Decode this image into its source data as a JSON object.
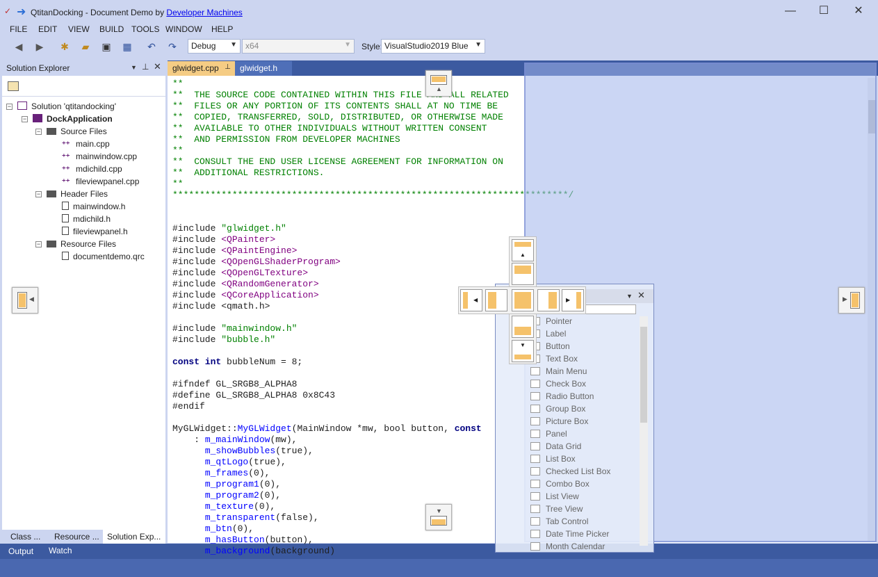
{
  "window": {
    "title": "QtitanDocking - Document Demo by ",
    "title_link": "Developer Machines",
    "minimize": "—",
    "maximize": "☐",
    "close": "✕"
  },
  "menu": [
    "FILE",
    "EDIT",
    "VIEW",
    "BUILD",
    "TOOLS",
    "WINDOW",
    "HELP"
  ],
  "toolbar": {
    "config_value": "Debug",
    "platform_value": "x64",
    "style_label": "Style:",
    "style_value": "VisualStudio2019 Blue"
  },
  "solution_explorer": {
    "title": "Solution Explorer",
    "tree": [
      {
        "label": "Solution 'qtitandocking'",
        "level": 0,
        "kind": "solution"
      },
      {
        "label": "DockApplication",
        "level": 1,
        "kind": "project"
      },
      {
        "label": "Source Files",
        "level": 2,
        "kind": "folder"
      },
      {
        "label": "main.cpp",
        "level": 3,
        "kind": "cpp"
      },
      {
        "label": "mainwindow.cpp",
        "level": 3,
        "kind": "cpp"
      },
      {
        "label": "mdichild.cpp",
        "level": 3,
        "kind": "cpp"
      },
      {
        "label": "fileviewpanel.cpp",
        "level": 3,
        "kind": "cpp"
      },
      {
        "label": "Header Files",
        "level": 2,
        "kind": "folder"
      },
      {
        "label": "mainwindow.h",
        "level": 3,
        "kind": "h"
      },
      {
        "label": "mdichild.h",
        "level": 3,
        "kind": "h"
      },
      {
        "label": "fileviewpanel.h",
        "level": 3,
        "kind": "h"
      },
      {
        "label": "Resource Files",
        "level": 2,
        "kind": "folder"
      },
      {
        "label": "documentdemo.qrc",
        "level": 3,
        "kind": "h"
      }
    ]
  },
  "left_tabs": [
    "Class ...",
    "Resource ...",
    "Solution Exp..."
  ],
  "bottom_tabs": [
    "Output",
    "Watch"
  ],
  "editor_tabs": [
    "glwidget.cpp",
    "glwidget.h"
  ],
  "code_lines": [
    "**",
    "**  THE SOURCE CODE CONTAINED WITHIN THIS FILE AND ALL RELATED",
    "**  FILES OR ANY PORTION OF ITS CONTENTS SHALL AT NO TIME BE",
    "**  COPIED, TRANSFERRED, SOLD, DISTRIBUTED, OR OTHERWISE MADE",
    "**  AVAILABLE TO OTHER INDIVIDUALS WITHOUT WRITTEN CONSENT",
    "**  AND PERMISSION FROM DEVELOPER MACHINES",
    "**",
    "**  CONSULT THE END USER LICENSE AGREEMENT FOR INFORMATION ON",
    "**  ADDITIONAL RESTRICTIONS.",
    "**",
    "*************************************************************************/"
  ],
  "includes": [
    [
      "#include ",
      "\"glwidget.h\"",
      "s"
    ],
    [
      "#include ",
      "<QPainter>",
      "q"
    ],
    [
      "#include ",
      "<QPaintEngine>",
      "q"
    ],
    [
      "#include ",
      "<QOpenGLShaderProgram>",
      "q"
    ],
    [
      "#include ",
      "<QOpenGLTexture>",
      "q"
    ],
    [
      "#include ",
      "<QRandomGenerator>",
      "q"
    ],
    [
      "#include ",
      "<QCoreApplication>",
      "q"
    ],
    [
      "#include ",
      "<qmath.h>",
      "n"
    ]
  ],
  "code2": {
    "inc1": "\"mainwindow.h\"",
    "inc2": "\"bubble.h\"",
    "bubble_kw": "const int",
    "bubble_rest": " bubbleNum = 8;",
    "ifndef": "#ifndef GL_SRGB8_ALPHA8",
    "define": "#define GL_SRGB8_ALPHA8 0x8C43",
    "endif": "#endif",
    "ctor_a": "MyGLWidget::",
    "ctor_b": "MyGLWidget",
    "ctor_c": "(MainWindow *mw, bool button, ",
    "ctor_d": "const"
  },
  "init_list": [
    [
      "    : ",
      "m_mainWindow",
      "(mw),"
    ],
    [
      "      ",
      "m_showBubbles",
      "(true),"
    ],
    [
      "      ",
      "m_qtLogo",
      "(true),"
    ],
    [
      "      ",
      "m_frames",
      "(0),"
    ],
    [
      "      ",
      "m_program1",
      "(0),"
    ],
    [
      "      ",
      "m_program2",
      "(0),"
    ],
    [
      "      ",
      "m_texture",
      "(0),"
    ],
    [
      "      ",
      "m_transparent",
      "(false),"
    ],
    [
      "      ",
      "m_btn",
      "(0),"
    ],
    [
      "      ",
      "m_hasButton",
      "(button),"
    ],
    [
      "      ",
      "m_background",
      "(background)"
    ]
  ],
  "toolbox_items": [
    "Pointer",
    "Label",
    "Button",
    "Text Box",
    "Main Menu",
    "Check Box",
    "Radio Button",
    "Group Box",
    "Picture Box",
    "Panel",
    "Data Grid",
    "List Box",
    "Checked List Box",
    "Combo Box",
    "List View",
    "Tree View",
    "Tab Control",
    "Date Time Picker",
    "Month Calendar"
  ]
}
